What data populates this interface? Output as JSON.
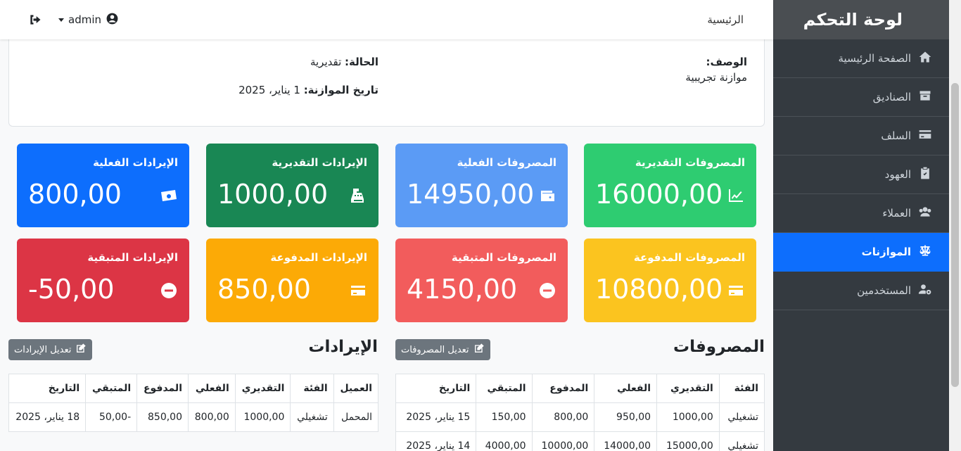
{
  "sidebar": {
    "title": "لوحة التحكم",
    "items": [
      {
        "label": "الصفحة الرئيسية",
        "icon": "home-icon"
      },
      {
        "label": "الصناديق",
        "icon": "box-icon"
      },
      {
        "label": "السلف",
        "icon": "credit-card-icon"
      },
      {
        "label": "العهود",
        "icon": "clipboard-check-icon"
      },
      {
        "label": "العملاء",
        "icon": "users-icon"
      },
      {
        "label": "الموازنات",
        "icon": "scale-icon",
        "active": true
      },
      {
        "label": "المستخدمين",
        "icon": "user-cog-icon"
      }
    ]
  },
  "navbar": {
    "home": "الرئيسية",
    "user": "admin"
  },
  "info": {
    "desc_label": "الوصف:",
    "desc_value": "موازنة تجريبية",
    "status_label": "الحالة:",
    "status_value": "تقديرية",
    "date_label": "تاريخ الموازنة:",
    "date_value": "1 يناير، 2025"
  },
  "stats": [
    {
      "title": "المصروفات التقديرية",
      "value": "16000,00",
      "color": "#2ecc71",
      "icon": "chart-line-icon"
    },
    {
      "title": "المصروفات الفعلية",
      "value": "14950,00",
      "color": "#5b9bf5",
      "icon": "wallet-icon"
    },
    {
      "title": "الإيرادات التقديرية",
      "value": "1000,00",
      "color": "#198754",
      "icon": "cash-register-icon"
    },
    {
      "title": "الإيرادات الفعلية",
      "value": "800,00",
      "color": "#0d6efd",
      "icon": "money-bill-icon"
    },
    {
      "title": "المصروفات المدفوعة",
      "value": "10800,00",
      "color": "#fbc41f",
      "icon": "credit-card-icon"
    },
    {
      "title": "المصروفات المتبقية",
      "value": "4150,00",
      "color": "#f25c5c",
      "icon": "minus-circle-icon"
    },
    {
      "title": "الإيرادات المدفوعة",
      "value": "850,00",
      "color": "#fcaa06",
      "icon": "credit-card-icon"
    },
    {
      "title": "الإيرادات المتبقية",
      "value": "-50,00",
      "color": "#dc3545",
      "icon": "minus-circle-icon"
    }
  ],
  "expenses": {
    "title": "المصروفات",
    "edit_label": "تعديل المصروفات",
    "headers": [
      "الفئة",
      "التقديري",
      "الفعلي",
      "المدفوع",
      "المتبقي",
      "التاريخ"
    ],
    "rows": [
      [
        "تشغيلي",
        "1000,00",
        "950,00",
        "800,00",
        "150,00",
        "15 يناير، 2025"
      ],
      [
        "تشغيلي",
        "15000,00",
        "14000,00",
        "10000,00",
        "4000,00",
        "14 يناير، 2025"
      ]
    ]
  },
  "revenues": {
    "title": "الإيرادات",
    "edit_label": "تعديل الإيرادات",
    "headers": [
      "العميل",
      "الفئة",
      "التقديري",
      "الفعلي",
      "المدفوع",
      "المتبقي",
      "التاريخ"
    ],
    "rows": [
      [
        "المحمل",
        "تشغيلي",
        "1000,00",
        "800,00",
        "850,00",
        "-50,00",
        "18 يناير، 2025"
      ]
    ]
  }
}
